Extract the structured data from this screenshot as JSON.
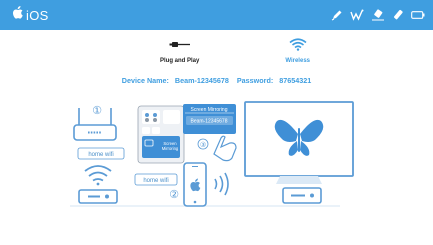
{
  "header": {
    "brand_label": "iOS",
    "icons": [
      "apple-logo-icon",
      "pen-icon",
      "annotate-icon",
      "eraser-icon",
      "highlight-icon",
      "battery-icon"
    ]
  },
  "modes": [
    {
      "label": "Plug and Play",
      "icon": "usb-cable-icon",
      "active": false
    },
    {
      "label": "Wireless",
      "icon": "wifi-icon",
      "active": true
    }
  ],
  "device": {
    "name_label": "Device Name:",
    "name_value": "Beam-12345678",
    "password_label": "Password:",
    "password_value": "87654321"
  },
  "illustration": {
    "step1_number": "①",
    "step2_number": "②",
    "step3_number": "③",
    "router_caption": "home wifi",
    "device_caption": "home wifi",
    "menu_title": "Screen Mirroring",
    "menu_device": "Beam-12345678",
    "tile_line1": "Screen",
    "tile_line2": "Mirroring"
  },
  "colors": {
    "accent": "#3f9ee0",
    "background": "#ffffff",
    "illustration_line": "#5b9bd5"
  }
}
